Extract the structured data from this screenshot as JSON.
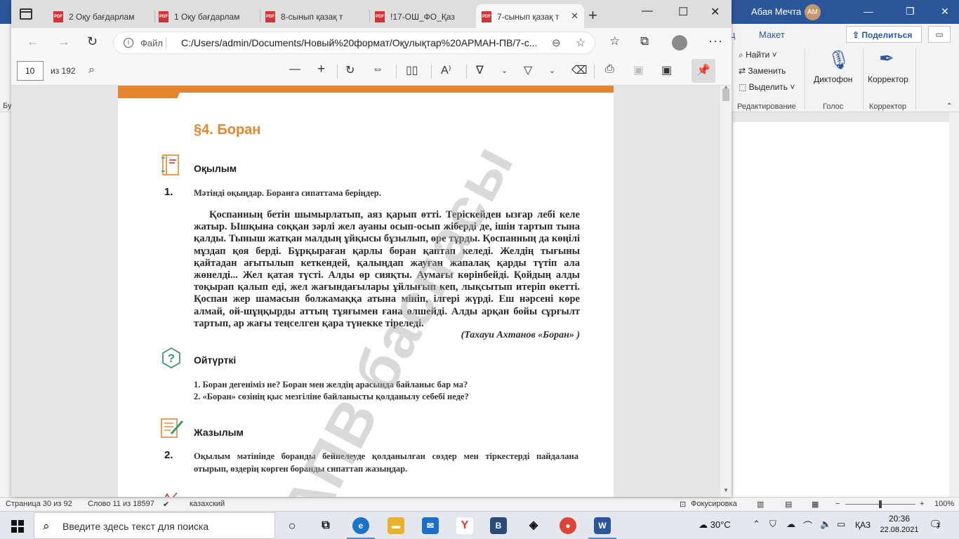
{
  "word": {
    "user_name": "Абая Мечта",
    "user_initials": "AM",
    "tab_fragment": "ц",
    "tab_layout": "Макет",
    "share_label": "Поделиться",
    "ribbon": {
      "find": "Найти",
      "replace": "Заменить",
      "select": "Выделить",
      "group_editing": "Редактирование",
      "dictate": "Диктофон",
      "group_voice": "Голос",
      "editor": "Корректор",
      "group_editor": "Корректор"
    },
    "left_cut_label": "Бус",
    "status": {
      "page": "Страница 30 из 92",
      "words": "Слово 11 из 18597",
      "language": "казахский",
      "focus": "Фокусировка",
      "zoom": "100%"
    }
  },
  "edge": {
    "tabs": [
      {
        "label": "2 Оқу бағдарлам",
        "active": false
      },
      {
        "label": "1 Оқу бағдарлам",
        "active": false
      },
      {
        "label": "8-сынып қазақ т",
        "active": false
      },
      {
        "label": "!17-ОШ_ФО_Қаз",
        "active": false
      },
      {
        "label": "7-сынып қазақ т",
        "active": true
      }
    ],
    "address": {
      "scheme_label": "Файл",
      "url": "C:/Users/admin/Documents/Новый%20формат/Оқулықтар%20АРМАН-ПВ/7-с..."
    },
    "pdf_toolbar": {
      "page_value": "10",
      "page_total": "из 192"
    }
  },
  "pdf": {
    "section_title": "§4.  Боран",
    "reading_head": "Оқылым",
    "task1_num": "1.",
    "task1_text": "Мәтінді оқыңдар. Боранға сипаттама беріңдер.",
    "reading_text": "Қоспанның бетін шымырлатып, аяз қарып өтті. Теріскейден ызғар лебі келе жатыр. Ышқына соққан зәрлі жел ауаны осып-осып жіберді де, ішін тартып тына қалды. Тыныш жатқан малдың ұйқысы бұзылып, өре тұрды. Қоспанның да көңілі мұздап қоя берді. Бұрқыраған қарлы боран қаптап келеді. Желдің тығыны қайтадан ағытылып кеткендей, қалыңдап жауған жапалақ қарды түтіп ала жөнелді... Жел қатая түсті. Алды өр сияқты. Аумағы көрінбейді. Қойдың алды тоқырап қалып еді, жел жағындағылары ұйлығып кеп, лықсытып итеріп өкетті. Қоспан жер шамасын болжамаққа атына мініп, ілгері жүрді. Еш нәрсені көре алмай, ой-шұңқырды аттың тұяғымен ғана өлшейді. Алды арқан бойы сұрғылт тартып, ар жағы теңселген қара түнекке тіреледі.",
    "reading_author": "(Тахауи Ахтанов «Боран» )",
    "think_head": "Ойтүрткі",
    "questions": [
      "1.   Боран дегеніміз не? Боран мен желдің арасында байланыс бар ма?",
      "2.   «Боран» сөзінің қыс мезгіліне байланысты қолданылу себебі неде?"
    ],
    "writing_head": "Жазылым",
    "task2_num": "2.",
    "task2_text": "Оқылым мәтінінде боранды бейнелеуде қолданылған сөздер мен тіркестерді пайдалана отырып, өздерің көрген боранды сипаттап жазыңдар.",
    "watermark": "АПВ баспасы",
    "accent_color": "#e5852f"
  },
  "taskbar": {
    "search_placeholder": "Введите здесь текст для поиска",
    "weather": "30°C",
    "language": "ҚАЗ",
    "time": "20:36",
    "date": "22.08.2021",
    "notif_count": "1"
  }
}
